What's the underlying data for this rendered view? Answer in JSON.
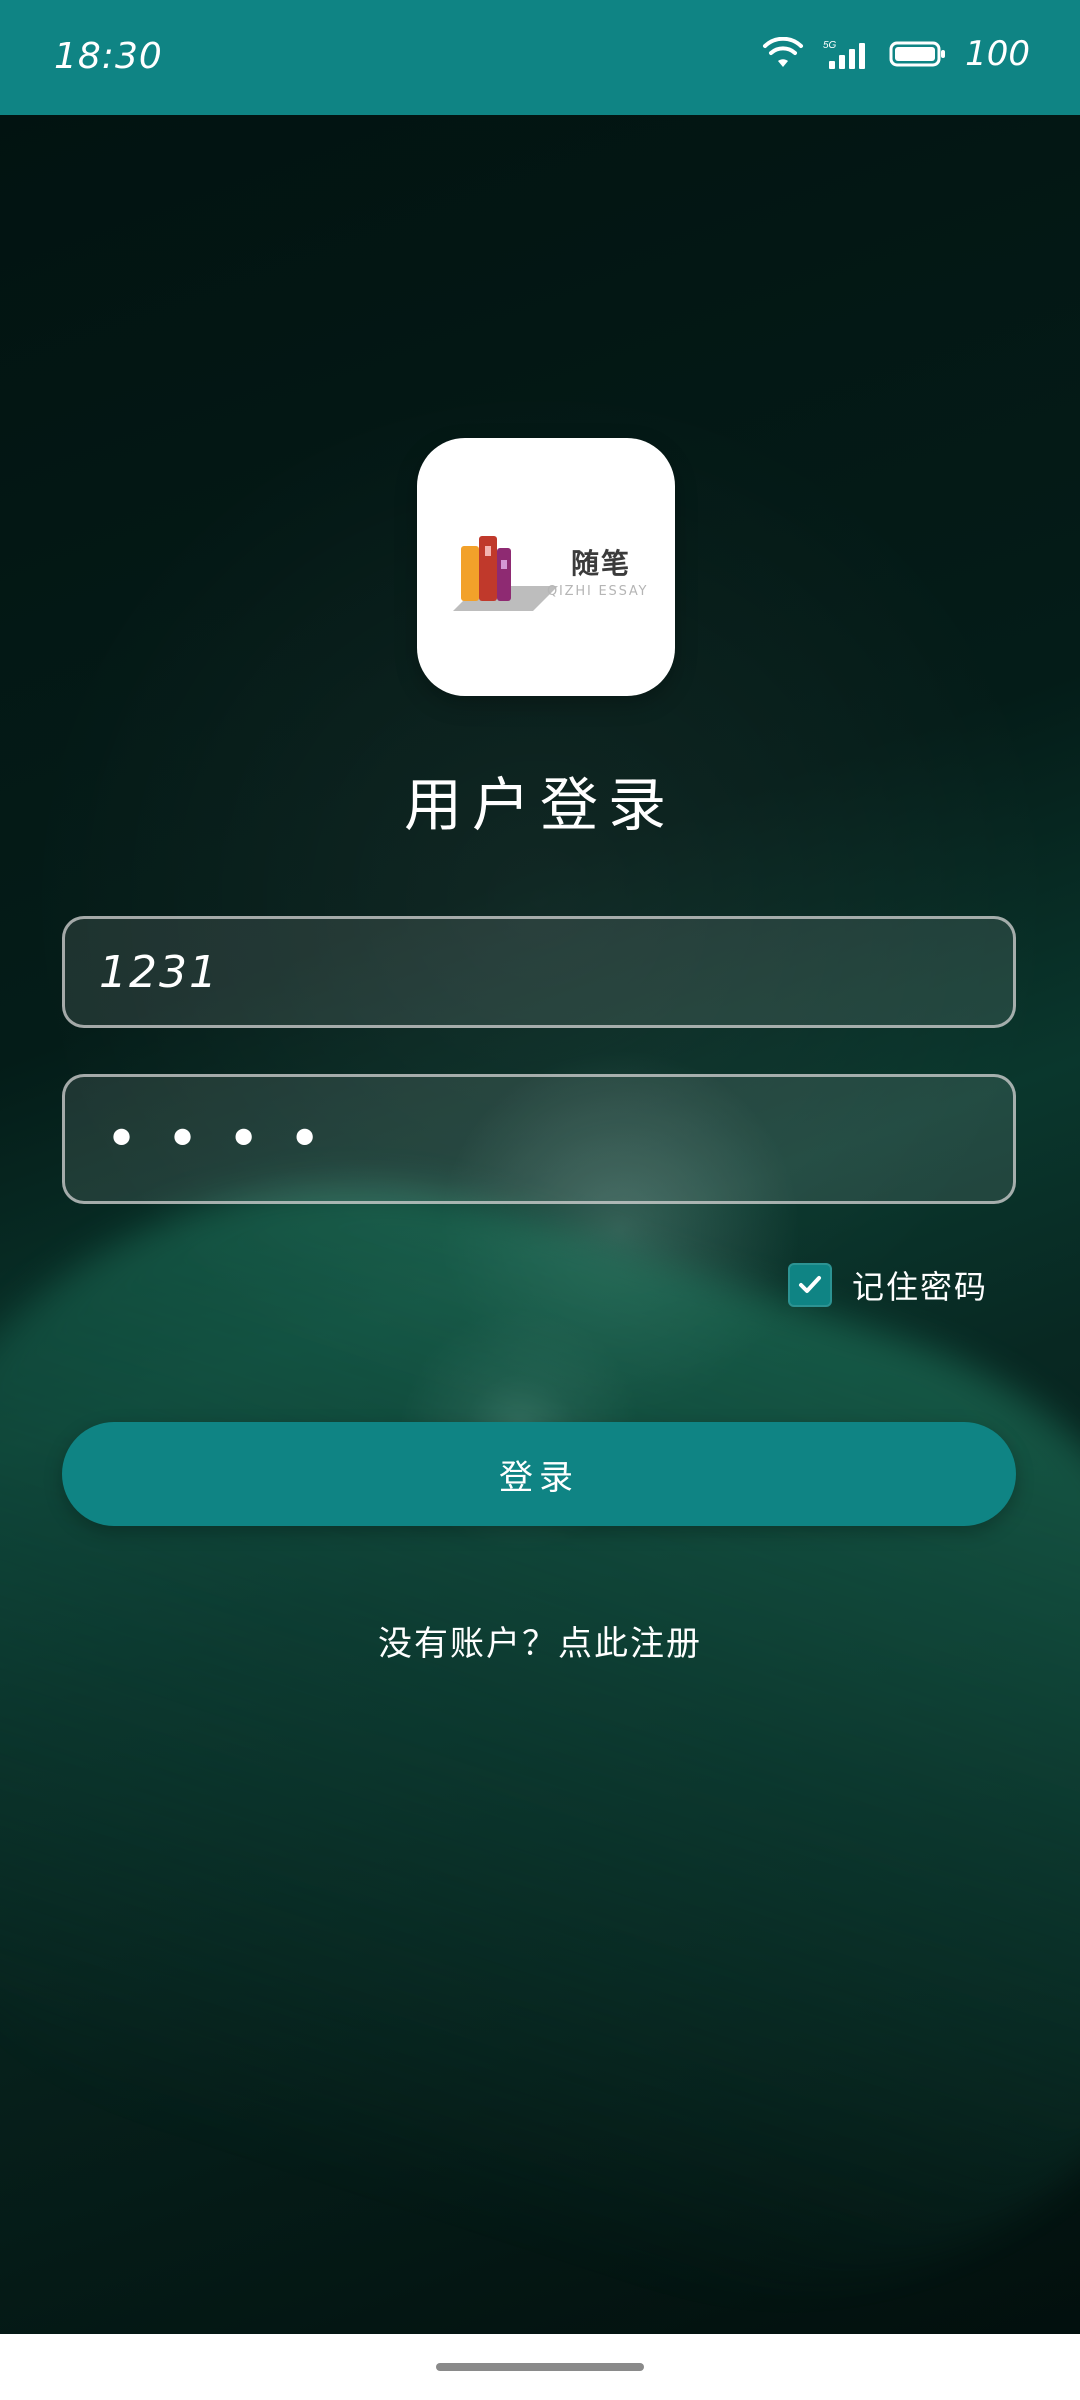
{
  "status_bar": {
    "time": "18:30",
    "network": "5G",
    "battery": "100",
    "icons": [
      "wifi-icon",
      "signal-icon",
      "battery-icon"
    ]
  },
  "logo": {
    "name": "随笔",
    "subtitle": "QIZHI ESSAY",
    "icon": "books-icon"
  },
  "title": "用户登录",
  "form": {
    "username_value": "1231",
    "password_mask": "••••"
  },
  "remember_password": {
    "checked": true,
    "label": "记住密码",
    "icon": "checkmark-icon"
  },
  "login_button_label": "登录",
  "register_link_text": "没有账户？点此注册",
  "colors": {
    "accent": "#0F8484",
    "status_bar": "#0F8484",
    "text": "#FFFFFF"
  }
}
